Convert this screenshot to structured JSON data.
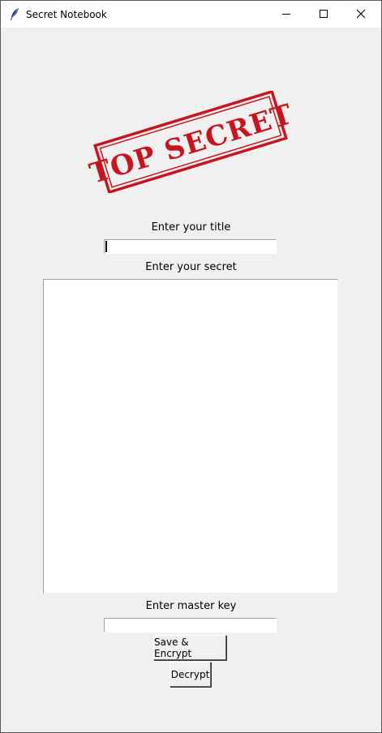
{
  "window": {
    "title": "Secret Notebook"
  },
  "stamp": {
    "text": "TOP SECRET",
    "color": "#c8141e"
  },
  "form": {
    "title_label": "Enter your title",
    "title_value": "",
    "secret_label": "Enter your secret",
    "secret_value": "",
    "master_label": "Enter master key",
    "master_value": ""
  },
  "buttons": {
    "save_label": "Save & Encrypt",
    "decrypt_label": "Decrypt"
  }
}
